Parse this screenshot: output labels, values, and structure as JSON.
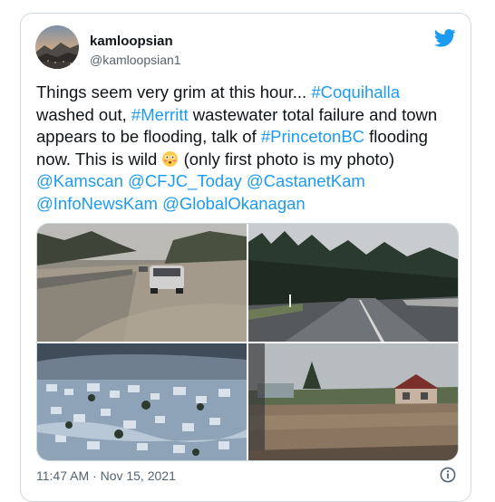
{
  "tweet": {
    "display_name": "kamloopsian",
    "handle": "@kamloopsian1",
    "text_segments": [
      {
        "t": "Things seem very grim at this hour... "
      },
      {
        "t": "#Coquihalla",
        "link": true
      },
      {
        "t": " washed out, "
      },
      {
        "t": "#Merritt",
        "link": true
      },
      {
        "t": " wastewater total failure and town appears to be flooding, talk of "
      },
      {
        "t": "#PrincetonBC",
        "link": true
      },
      {
        "t": " flooding now. This is wild "
      },
      {
        "emoji": "flushed-face-emoji"
      },
      {
        "t": " (only first photo is my photo) "
      },
      {
        "t": "@Kamscan",
        "link": true
      },
      {
        "t": " "
      },
      {
        "t": "@CFJC_Today",
        "link": true
      },
      {
        "t": " "
      },
      {
        "t": "@CastanetKam",
        "link": true
      },
      {
        "t": " "
      },
      {
        "t": "@InfoNewsKam",
        "link": true
      },
      {
        "t": " "
      },
      {
        "t": "@GlobalOkanagan",
        "link": true
      }
    ],
    "photos": [
      {
        "name": "photo-flooded-highway-car",
        "alt": ""
      },
      {
        "name": "photo-washed-road-forest",
        "alt": ""
      },
      {
        "name": "photo-aerial-flooded-town",
        "alt": ""
      },
      {
        "name": "photo-flooded-houses",
        "alt": ""
      }
    ],
    "time": "11:47 AM",
    "separator": "·",
    "date": "Nov 15, 2021"
  },
  "icons": {
    "brand": "twitter-bird-icon",
    "info": "info-icon",
    "emoji": "flushed-face-emoji"
  },
  "colors": {
    "link": "#1d9bf0",
    "brand": "#1d9bf0",
    "secondary_text": "#536471",
    "border": "#cfd9de"
  }
}
